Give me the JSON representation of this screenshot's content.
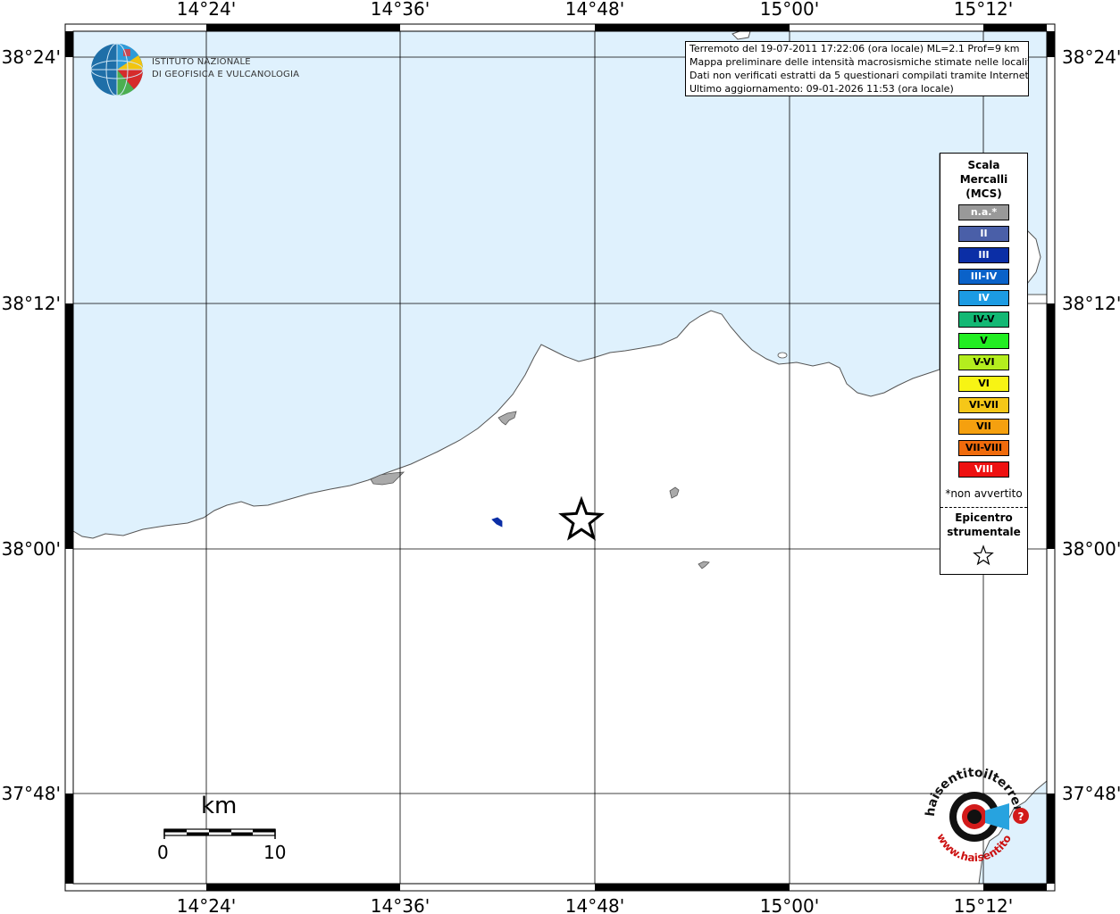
{
  "top_axis_labels": [
    "14°24'",
    "14°36'",
    "14°48'",
    "15°00'",
    "15°12'"
  ],
  "bottom_axis_labels": [
    "14°24'",
    "14°36'",
    "14°48'",
    "15°00'",
    "15°12'"
  ],
  "left_axis_labels": [
    "38°24'",
    "38°12'",
    "38°00'",
    "37°48'"
  ],
  "right_axis_labels": [
    "38°24'",
    "38°12'",
    "38°00'",
    "37°48'"
  ],
  "institute": {
    "line1": "ISTITUTO NAZIONALE",
    "line2": "DI GEOFISICA E VULCANOLOGIA"
  },
  "info": {
    "line1": "Terremoto del 19-07-2011 17:22:06 (ora locale) ML=2.1 Prof=9 km",
    "line2": "Mappa preliminare delle intensità macrosismiche stimate nelle località",
    "line3": "Dati non verificati estratti da 5 questionari compilati tramite Internet.",
    "line4": "Ultimo aggiornamento: 09-01-2026 11:53 (ora locale)"
  },
  "legend": {
    "title_line1": "Scala",
    "title_line2": "Mercalli",
    "title_line3": "(MCS)",
    "items": [
      {
        "label": "n.a.*",
        "color": "#999999",
        "text_color": "#ffffff"
      },
      {
        "label": "II",
        "color": "#4a5fa8",
        "text_color": "#ffffff"
      },
      {
        "label": "III",
        "color": "#0b2ea6",
        "text_color": "#ffffff"
      },
      {
        "label": "III-IV",
        "color": "#0a62c9",
        "text_color": "#ffffff"
      },
      {
        "label": "IV",
        "color": "#1c9be3",
        "text_color": "#ffffff"
      },
      {
        "label": "IV-V",
        "color": "#13b874",
        "text_color": "#000000"
      },
      {
        "label": "V",
        "color": "#22ee22",
        "text_color": "#000000"
      },
      {
        "label": "V-VI",
        "color": "#b4ee1e",
        "text_color": "#000000"
      },
      {
        "label": "VI",
        "color": "#f7f414",
        "text_color": "#000000"
      },
      {
        "label": "VI-VII",
        "color": "#f5c718",
        "text_color": "#000000"
      },
      {
        "label": "VII",
        "color": "#f5a00f",
        "text_color": "#000000"
      },
      {
        "label": "VII-VIII",
        "color": "#f06b0c",
        "text_color": "#000000"
      },
      {
        "label": "VIII",
        "color": "#ee1111",
        "text_color": "#ffffff"
      }
    ],
    "note": "*non avvertito",
    "epicenter_line1": "Epicentro",
    "epicenter_line2": "strumentale"
  },
  "scale_bar": {
    "unit": "km",
    "start": "0",
    "end": "10"
  },
  "colors": {
    "sea": "#dff1fd",
    "land": "#ffffff",
    "coast": "#555555",
    "small_lake": "#aaaaaa",
    "intensity_marker": "#0b2ea6"
  },
  "haisentito_logo": {
    "text_top": "haisentitoilterremoto.it",
    "text_bottom": "www.haisentito"
  }
}
